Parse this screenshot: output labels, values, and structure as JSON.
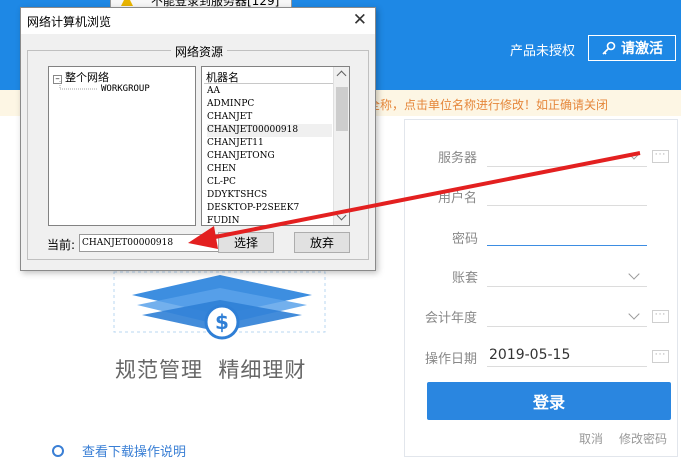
{
  "header": {
    "unlicensed_text": "产品未授权",
    "activate_label": "请激活",
    "partial_title": "不能登录到服务器[129]"
  },
  "notice": {
    "text": "全称，点击单位名称进行修改！如正确请关闭"
  },
  "brand": {
    "slogan": "规范管理  精细理财",
    "bottom_link": "查看下载操作说明"
  },
  "login_form": {
    "server_label": "服务器",
    "user_label": "用户名",
    "password_label": "密码",
    "account_label": "账套",
    "year_label": "会计年度",
    "date_label": "操作日期",
    "date_value": "2019-05-15",
    "login_button": "登录",
    "cancel_link": "取消",
    "change_pwd_link": "修改密码"
  },
  "dialog": {
    "title": "网络计算机浏览",
    "group_label": "网络资源",
    "tree_root": "整个网络",
    "tree_child": "WORKGROUP",
    "list_header": "机器名",
    "machines": [
      "AA",
      "ADMINPC",
      "CHANJET",
      "CHANJET00000918",
      "CHANJET11",
      "CHANJETONG",
      "CHEN",
      "CL-PC",
      "DDYKTSHCS",
      "DESKTOP-P2SEEK7",
      "FUDIN"
    ],
    "current_label": "当前:",
    "current_value": "CHANJET00000918",
    "select_button": "选择",
    "cancel_button": "放弃"
  },
  "colors": {
    "header_bg": "#1e88e5",
    "notice_text": "#e5873b",
    "login_button": "#2a86e0",
    "annotation_arrow": "#e32020"
  },
  "icons": {
    "activate": "key-icon",
    "close": "close-icon",
    "bottom_link": "gear-icon"
  }
}
